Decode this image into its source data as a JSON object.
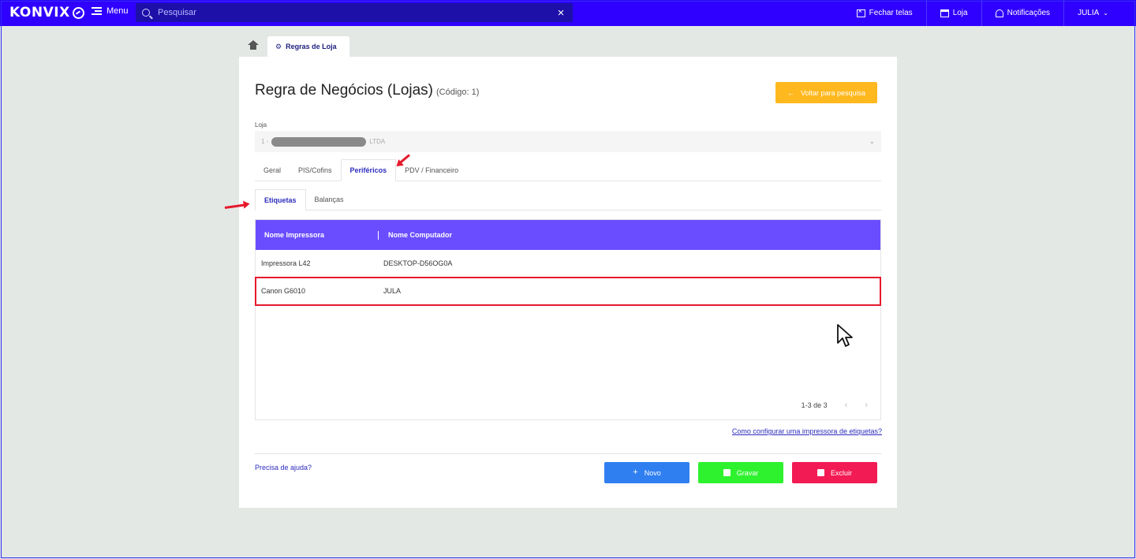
{
  "app": {
    "logo": "KONVIX"
  },
  "topbar": {
    "menu_label": "Menu",
    "search_placeholder": "Pesquisar",
    "close_tabs_label": "Fechar telas",
    "store_label": "Loja",
    "notifications_label": "Notificações",
    "user_label": "JULIA"
  },
  "crumbs": {
    "page_tab": "Regras de Loja"
  },
  "page": {
    "title": "Regra de Negócios (Lojas)",
    "subtitle": "(Código: 1)",
    "back_button": "Voltar para pesquisa"
  },
  "loja": {
    "label": "Loja",
    "value_prefix": "1 -",
    "value_suffix": "LTDA"
  },
  "tabs": [
    "Geral",
    "PIS/Cofins",
    "Periféricos",
    "PDV / Financeiro"
  ],
  "active_tab": "Periféricos",
  "subtabs": [
    "Etiquetas",
    "Balanças"
  ],
  "active_subtab": "Etiquetas",
  "grid": {
    "columns": [
      "Nome Impressora",
      "Nome Computador"
    ],
    "rows": [
      {
        "printer": "Impressora L42",
        "computer": "DESKTOP-D56OG0A"
      },
      {
        "printer": "Canon G6010",
        "computer": "JULA"
      }
    ],
    "pagination": "1-3 de 3"
  },
  "links": {
    "configure_printer": "Como configurar uma impressora de etiquetas?",
    "need_help": "Precisa de ajuda?"
  },
  "actions": {
    "new": "Novo",
    "save": "Gravar",
    "delete": "Excluir"
  },
  "colors": {
    "topbar": "#2f00ff",
    "grid_header": "#6a4dff",
    "btn_new": "#2f7ff1",
    "btn_save": "#2ef22e",
    "btn_delete": "#f21b54",
    "btn_back": "#ffb81e",
    "annotation": "#e5192c"
  }
}
